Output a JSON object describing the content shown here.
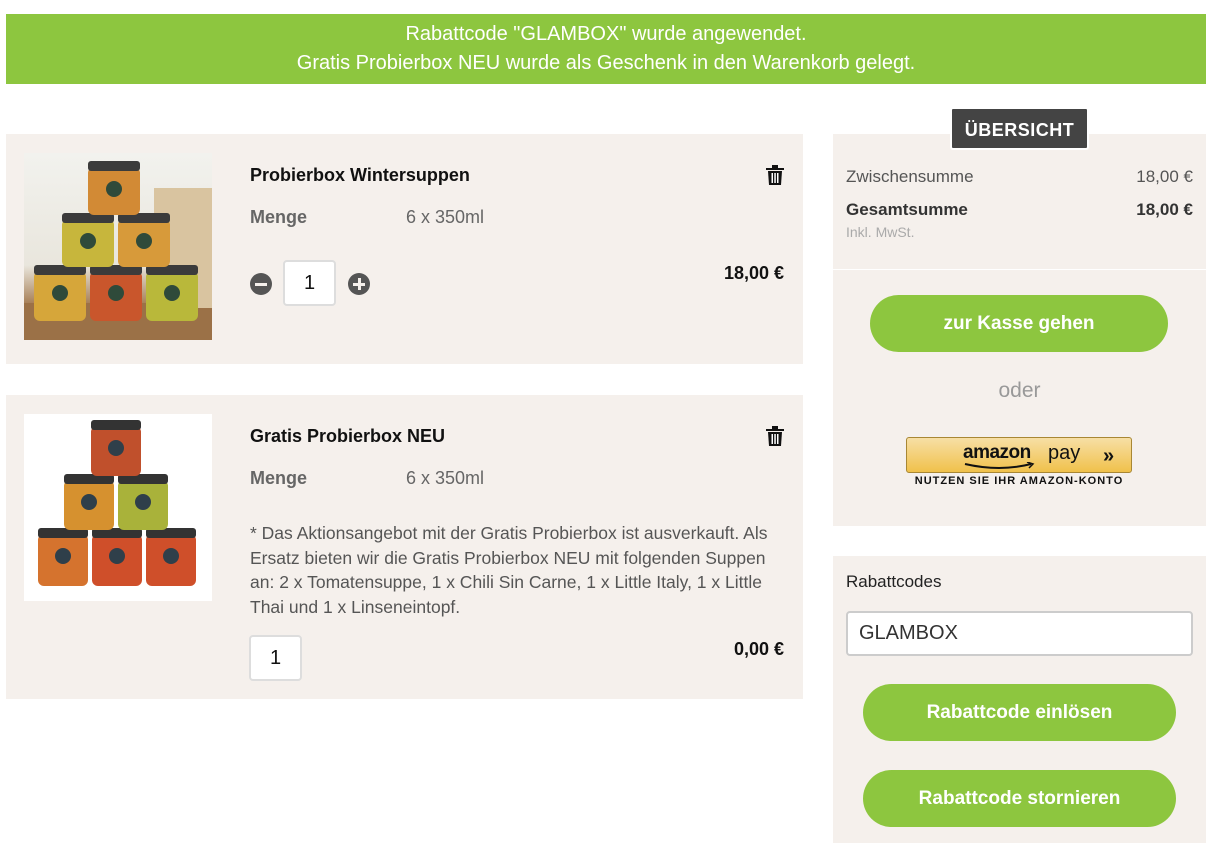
{
  "banner": {
    "line1": "Rabattcode \"GLAMBOX\" wurde angewendet.",
    "line2": "Gratis Probierbox NEU wurde als Geschenk in den Warenkorb gelegt."
  },
  "cart": {
    "items": [
      {
        "title": "Probierbox Wintersuppen",
        "menge_label": "Menge",
        "menge_value": "6 x 350ml",
        "quantity": "1",
        "price": "18,00 €"
      },
      {
        "title": "Gratis Probierbox NEU",
        "menge_label": "Menge",
        "menge_value": "6 x 350ml",
        "note": "* Das Aktionsangebot mit der Gratis Probierbox ist ausverkauft. Als Ersatz bieten wir die Gratis Probierbox NEU mit folgenden Suppen an: 2 x Tomatensuppe, 1 x Chili Sin Carne, 1 x Little Italy, 1 x Little Thai und 1 x Linseneintopf.",
        "quantity": "1",
        "price": "0,00 €"
      }
    ]
  },
  "summary": {
    "badge": "ÜBERSICHT",
    "subtotal_label": "Zwischensumme",
    "subtotal_value": "18,00 €",
    "total_label": "Gesamtsumme",
    "total_value": "18,00 €",
    "tax_note": "Inkl. MwSt.",
    "checkout_label": "zur Kasse gehen",
    "or_label": "oder",
    "amazon_logo": "amazon",
    "amazon_pay": "pay",
    "amazon_caption": "NUTZEN SIE IHR AMAZON-KONTO"
  },
  "coupon": {
    "label": "Rabattcodes",
    "value": "GLAMBOX",
    "redeem_label": "Rabattcode einlösen",
    "cancel_label": "Rabattcode stornieren"
  },
  "colors": {
    "accent": "#8dc63f",
    "panel": "#f5f0ec",
    "badge": "#444444"
  }
}
